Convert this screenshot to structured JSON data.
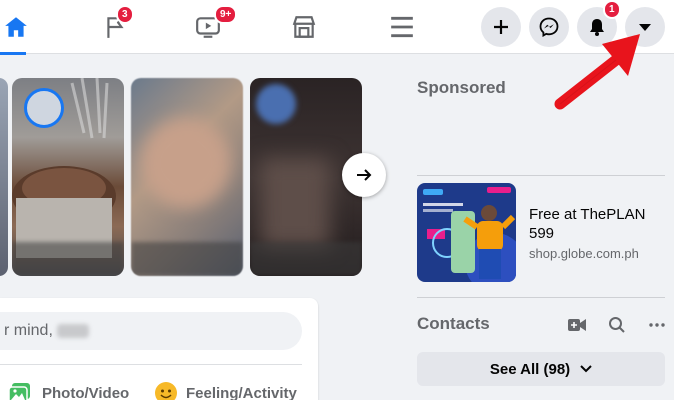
{
  "topbar": {
    "badges": {
      "pages": "3",
      "watch": "9+",
      "notifications": "1"
    },
    "tabs": [
      "home",
      "pages",
      "watch",
      "marketplace",
      "menu"
    ]
  },
  "composer": {
    "placeholder_partial": "r mind,",
    "photo_video_label": "Photo/Video",
    "feeling_activity_label": "Feeling/Activity"
  },
  "sponsored": {
    "title": "Sponsored",
    "ad_title": "Free at ThePLAN 599",
    "ad_url": "shop.globe.com.ph"
  },
  "contacts": {
    "title": "Contacts",
    "see_all_label": "See All (98)"
  },
  "colors": {
    "accent": "#1877f2",
    "badge": "#e41e3f",
    "arrow": "#e8141c"
  }
}
